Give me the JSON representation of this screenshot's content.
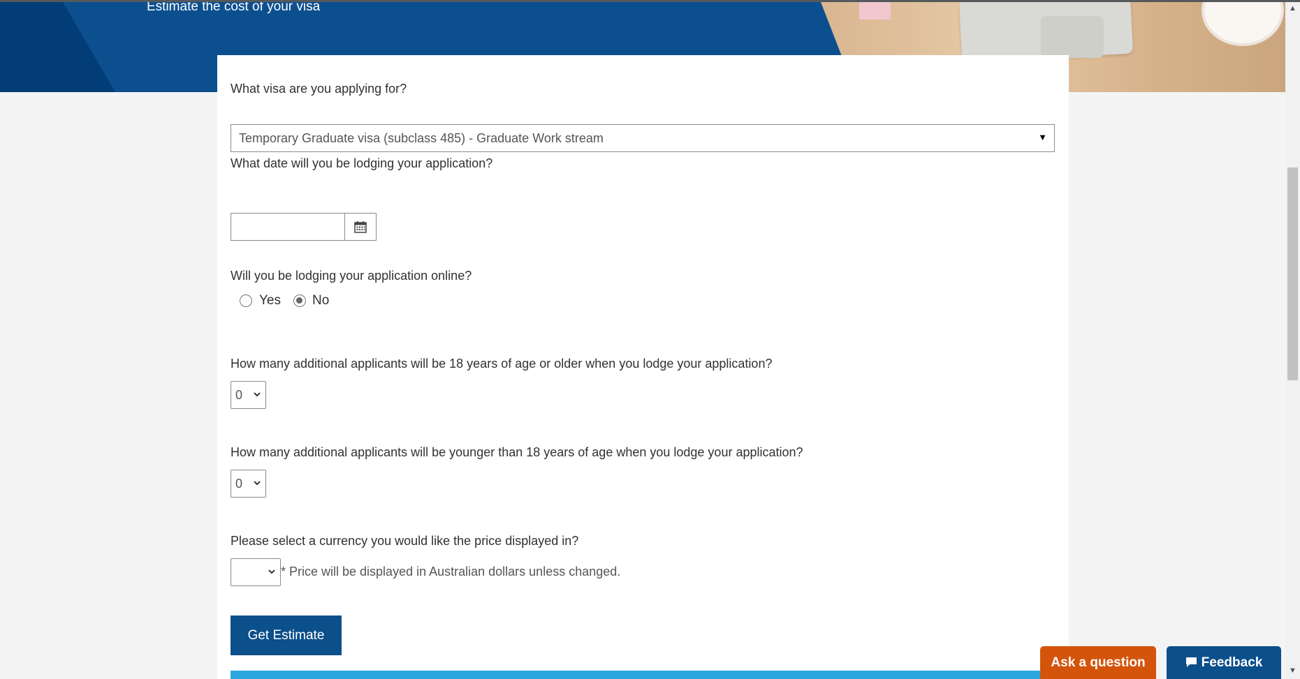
{
  "hero": {
    "subtitle": "Estimate the cost of your visa"
  },
  "form": {
    "visa_question": "What visa are you applying for?",
    "visa_selected": "Temporary Graduate visa (subclass 485) - Graduate Work stream",
    "date_question": "What date will you be lodging your application?",
    "date_value": "",
    "online_question": "Will you be lodging your application online?",
    "online_options": [
      {
        "label": "Yes",
        "checked": false
      },
      {
        "label": "No",
        "checked": true
      }
    ],
    "adults_question": "How many additional applicants will be 18 years of age or older when you lodge your application?",
    "adults_selected": "0",
    "children_question": "How many additional applicants will be younger than 18 years of age when you lodge your application?",
    "children_selected": "0",
    "currency_question": "Please select a currency you would like the price displayed in?",
    "currency_selected": "",
    "currency_note": "* Price will be displayed in Australian dollars unless changed.",
    "submit_label": "Get Estimate"
  },
  "floating": {
    "ask_label": "Ask a question",
    "feedback_label": "Feedback"
  },
  "colors": {
    "brand_blue": "#0b4f8b",
    "ask_orange": "#d4540b",
    "accent_cyan": "#2aa7de"
  },
  "icons": {
    "calendar": "calendar-icon",
    "feedback": "chat-icon"
  }
}
